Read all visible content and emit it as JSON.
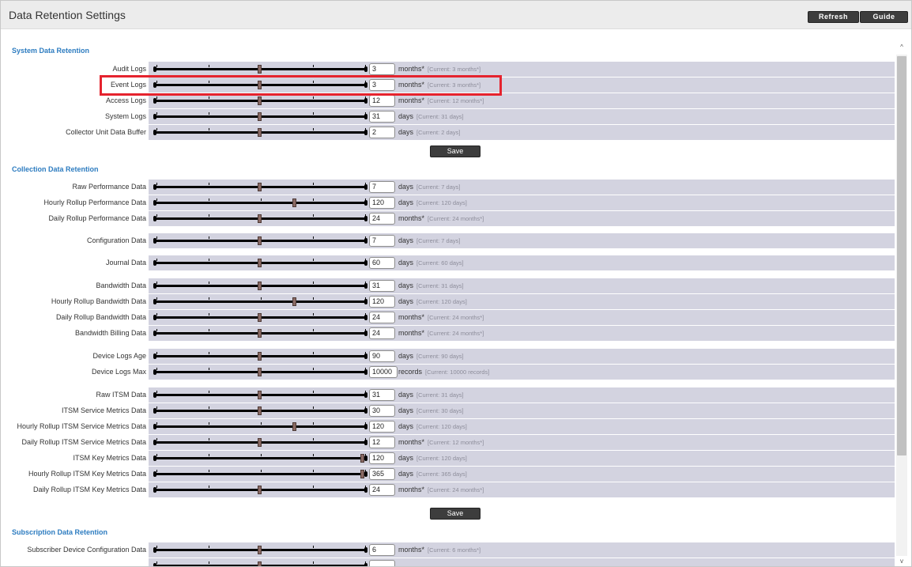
{
  "window": {
    "title": "Data Retention Settings"
  },
  "toolbar": {
    "refresh_label": "Refresh",
    "guide_label": "Guide"
  },
  "sections": [
    {
      "title": "System Data Retention",
      "save_label": "Save",
      "rows": [
        {
          "label": "Audit Logs",
          "value": "3",
          "unit": "months*",
          "current": "[Current: 3 months*]",
          "slider_fraction": 0.5,
          "highlighted": false
        },
        {
          "label": "Event Logs",
          "value": "3",
          "unit": "months*",
          "current": "[Current: 3 months*]",
          "slider_fraction": 0.5,
          "highlighted": true
        },
        {
          "label": "Access Logs",
          "value": "12",
          "unit": "months*",
          "current": "[Current: 12 months*]",
          "slider_fraction": 0.5,
          "highlighted": false
        },
        {
          "label": "System Logs",
          "value": "31",
          "unit": "days",
          "current": "[Current: 31 days]",
          "slider_fraction": 0.5,
          "highlighted": false
        },
        {
          "label": "Collector Unit Data Buffer",
          "value": "2",
          "unit": "days",
          "current": "[Current: 2 days]",
          "slider_fraction": 0.5,
          "highlighted": false
        }
      ]
    },
    {
      "title": "Collection Data Retention",
      "save_label": "Save",
      "rows": [
        {
          "label": "Raw Performance Data",
          "value": "7",
          "unit": "days",
          "current": "[Current: 7 days]",
          "slider_fraction": 0.5
        },
        {
          "label": "Hourly Rollup Performance Data",
          "value": "120",
          "unit": "days",
          "current": "[Current: 120 days]",
          "slider_fraction": 0.67
        },
        {
          "label": "Daily Rollup Performance Data",
          "value": "24",
          "unit": "months*",
          "current": "[Current: 24 months*]",
          "slider_fraction": 0.5
        },
        {
          "label": "Configuration Data",
          "value": "7",
          "unit": "days",
          "current": "[Current: 7 days]",
          "slider_fraction": 0.5
        },
        {
          "label": "Journal Data",
          "value": "60",
          "unit": "days",
          "current": "[Current: 60 days]",
          "slider_fraction": 0.5
        },
        {
          "label": "Bandwidth Data",
          "value": "31",
          "unit": "days",
          "current": "[Current: 31 days]",
          "slider_fraction": 0.5
        },
        {
          "label": "Hourly Rollup Bandwidth Data",
          "value": "120",
          "unit": "days",
          "current": "[Current: 120 days]",
          "slider_fraction": 0.67
        },
        {
          "label": "Daily Rollup Bandwidth Data",
          "value": "24",
          "unit": "months*",
          "current": "[Current: 24 months*]",
          "slider_fraction": 0.5
        },
        {
          "label": "Bandwidth Billing Data",
          "value": "24",
          "unit": "months*",
          "current": "[Current: 24 months*]",
          "slider_fraction": 0.5
        },
        {
          "label": "Device Logs Age",
          "value": "90",
          "unit": "days",
          "current": "[Current: 90 days]",
          "slider_fraction": 0.5
        },
        {
          "label": "Device Logs Max",
          "value": "10000",
          "unit": "records",
          "current": "[Current: 10000 records]",
          "slider_fraction": 0.5
        },
        {
          "label": "Raw ITSM Data",
          "value": "31",
          "unit": "days",
          "current": "[Current: 31 days]",
          "slider_fraction": 0.5
        },
        {
          "label": "ITSM Service Metrics Data",
          "value": "30",
          "unit": "days",
          "current": "[Current: 30 days]",
          "slider_fraction": 0.5
        },
        {
          "label": "Hourly Rollup ITSM Service Metrics Data",
          "value": "120",
          "unit": "days",
          "current": "[Current: 120 days]",
          "slider_fraction": 0.67
        },
        {
          "label": "Daily Rollup ITSM Service Metrics Data",
          "value": "12",
          "unit": "months*",
          "current": "[Current: 12 months*]",
          "slider_fraction": 0.5
        },
        {
          "label": "ITSM Key Metrics Data",
          "value": "120",
          "unit": "days",
          "current": "[Current: 120 days]",
          "slider_fraction": 1.0
        },
        {
          "label": "Hourly Rollup ITSM Key Metrics Data",
          "value": "365",
          "unit": "days",
          "current": "[Current: 365 days]",
          "slider_fraction": 1.0
        },
        {
          "label": "Daily Rollup ITSM Key Metrics Data",
          "value": "24",
          "unit": "months*",
          "current": "[Current: 24 months*]",
          "slider_fraction": 0.5
        }
      ]
    },
    {
      "title": "Subscription Data Retention",
      "rows": [
        {
          "label": "Subscriber Device Configuration Data",
          "value": "6",
          "unit": "months*",
          "current": "[Current: 6 months*]",
          "slider_fraction": 0.5
        },
        {
          "label": "",
          "value": "",
          "unit": "",
          "current": "",
          "slider_fraction": 0.5
        }
      ]
    }
  ],
  "colors": {
    "accent": "#2d7cc0",
    "highlight": "#e5232e",
    "row_panel": "#d3d3e0",
    "button": "#3d3d3d"
  },
  "icons": {
    "scroll_up": "chevron-up-icon",
    "scroll_down": "chevron-down-icon"
  },
  "glyphs": {
    "scroll_up": "^",
    "scroll_down": "v"
  }
}
